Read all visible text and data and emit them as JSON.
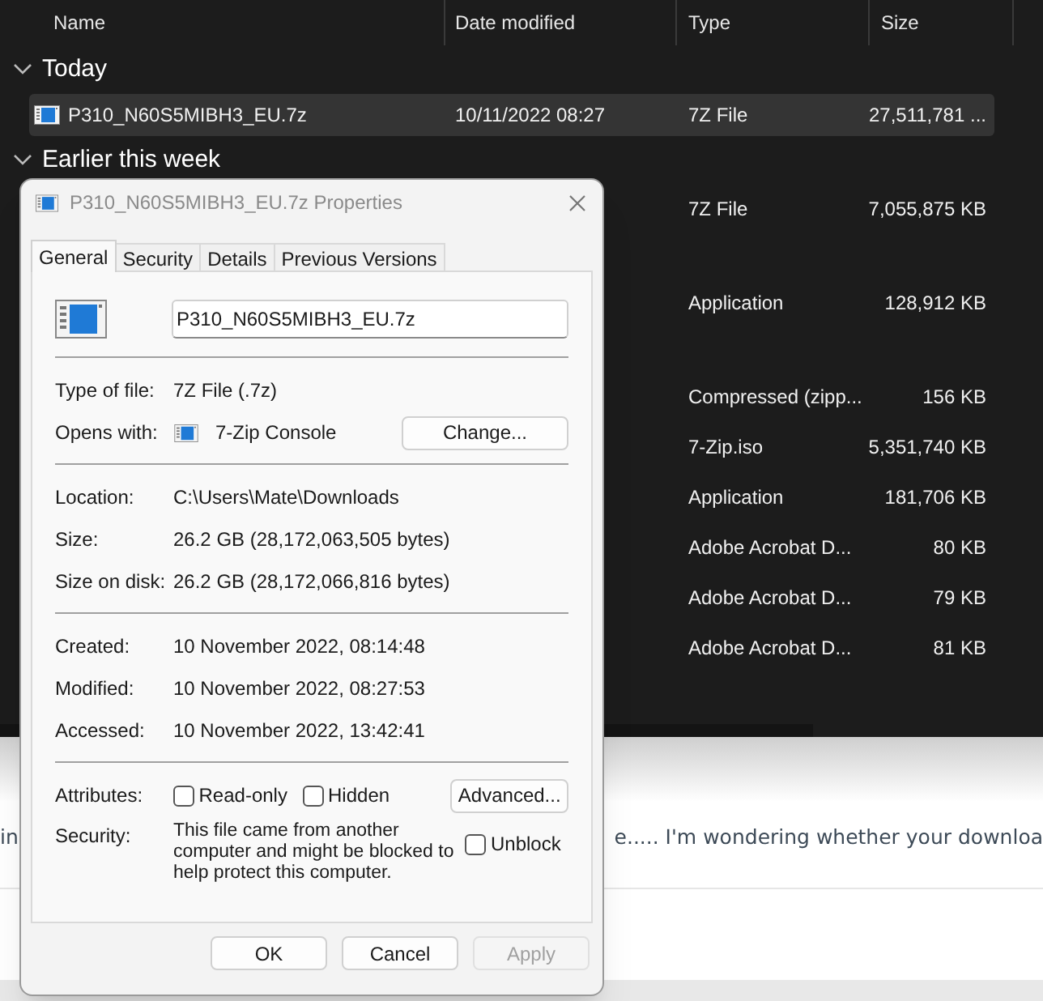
{
  "explorer": {
    "columns": [
      "Name",
      "Date modified",
      "Type",
      "Size"
    ],
    "groups": [
      {
        "label": "Today",
        "expanded": true,
        "rows": [
          {
            "name": "P310_N60S5MIBH3_EU.7z",
            "date": "10/11/2022 08:27",
            "type": "7Z File",
            "size": "27,511,781 ...",
            "selected": true
          }
        ]
      },
      {
        "label": "Earlier this week",
        "expanded": true,
        "rows": [
          {
            "type": "7Z File",
            "size": "7,055,875 KB",
            "selected": false
          },
          {
            "type": "Application",
            "size": "128,912 KB",
            "selected": false
          },
          {
            "type": "Compressed (zipp...",
            "size": "156 KB",
            "selected": false
          },
          {
            "type": "7-Zip.iso",
            "size": "5,351,740 KB",
            "selected": false
          },
          {
            "type": "Application",
            "size": "181,706 KB",
            "selected": false
          },
          {
            "type": "Adobe Acrobat D...",
            "size": "80 KB",
            "selected": false
          },
          {
            "type": "Adobe Acrobat D...",
            "size": "79 KB",
            "selected": false
          },
          {
            "type": "Adobe Acrobat D...",
            "size": "81 KB",
            "selected": false
          }
        ]
      }
    ]
  },
  "post_text": [
    "in",
    "e..... I'm wondering whether your downloa"
  ],
  "dialog": {
    "title": "P310_N60S5MIBH3_EU.7z Properties",
    "tabs": [
      {
        "label": "General",
        "selected": true
      },
      {
        "label": "Security",
        "selected": false
      },
      {
        "label": "Details",
        "selected": false
      },
      {
        "label": "Previous Versions",
        "selected": false
      }
    ],
    "filename": "P310_N60S5MIBH3_EU.7z",
    "sections": [
      [
        {
          "label": "Type of file:",
          "value": "7Z File (.7z)"
        },
        {
          "label": "Opens with:",
          "value": "7-Zip Console",
          "kind": "app",
          "button": "Change..."
        }
      ],
      [
        {
          "label": "Location:",
          "value": "C:\\Users\\Mate\\Downloads"
        },
        {
          "label": "Size:",
          "value": "26.2 GB (28,172,063,505 bytes)"
        },
        {
          "label": "Size on disk:",
          "value": "26.2 GB (28,172,066,816 bytes)"
        }
      ],
      [
        {
          "label": "Created:",
          "value": "10 November 2022, 08:14:48"
        },
        {
          "label": "Modified:",
          "value": "10 November 2022, 08:27:53"
        },
        {
          "label": "Accessed:",
          "value": "10 November 2022, 13:42:41"
        }
      ]
    ],
    "attributes": {
      "label": "Attributes:",
      "checkboxes": [
        {
          "label": "Read-only",
          "checked": false
        },
        {
          "label": "Hidden",
          "checked": false
        }
      ],
      "button": "Advanced..."
    },
    "security": {
      "label": "Security:",
      "text": "This file came from another computer and might be blocked to help protect this computer.",
      "checkbox": {
        "label": "Unblock",
        "checked": false
      }
    },
    "buttons": [
      {
        "label": "OK",
        "disabled": false
      },
      {
        "label": "Cancel",
        "disabled": false
      },
      {
        "label": "Apply",
        "disabled": true
      }
    ]
  }
}
